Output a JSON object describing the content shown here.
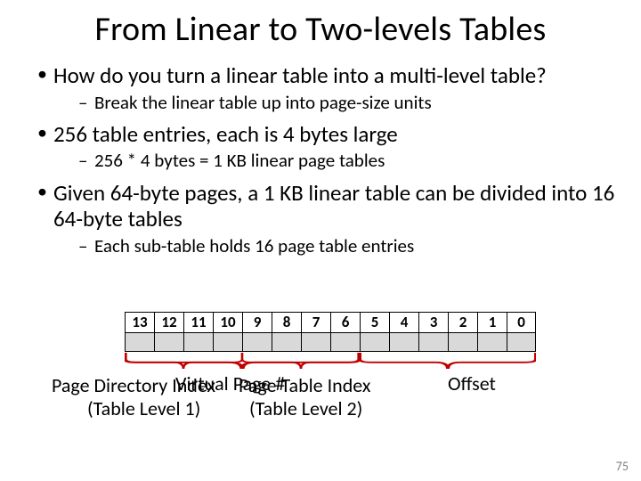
{
  "title": "From Linear to Two-levels Tables",
  "bullets": {
    "b1": "How do you turn a linear table into a multi-level table?",
    "b1s1": "Break the linear table up into page-size units",
    "b2": "256 table entries, each is 4 bytes large",
    "b2s1": "256 * 4 bytes = 1 KB linear page tables",
    "b3": "Given 64-byte pages, a 1 KB linear table can be divided into 16 64-byte tables",
    "b3s1": "Each sub-table holds 16 page table entries"
  },
  "bits": [
    "13",
    "12",
    "11",
    "10",
    "9",
    "8",
    "7",
    "6",
    "5",
    "4",
    "3",
    "2",
    "1",
    "0"
  ],
  "labels": {
    "pgdir_l1": "Page Directory Index",
    "pgdir_l2": "(Table Level 1)",
    "virt": "Virtual Page #",
    "pti_l1": "Page Table Index",
    "pti_l2": "(Table Level 2)",
    "offset": "Offset"
  },
  "page_number": "75"
}
